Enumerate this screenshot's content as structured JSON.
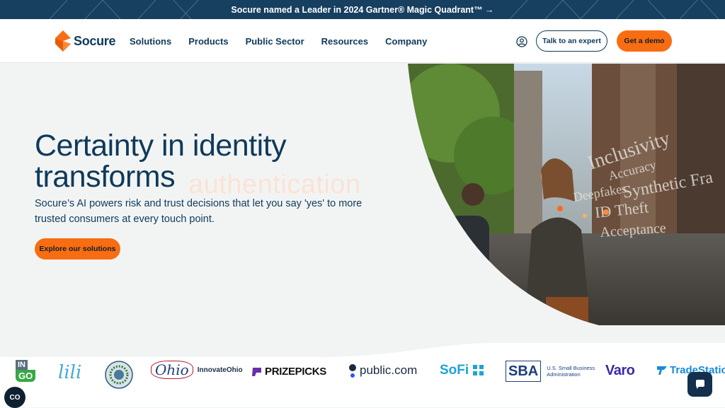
{
  "banner": {
    "text": "Socure named a Leader in 2024 Gartner® Magic Quadrant™ →"
  },
  "nav": {
    "logo_text": "Socure",
    "items": [
      "Solutions",
      "Products",
      "Public Sector",
      "Resources",
      "Company"
    ],
    "expert_label": "Talk to an expert",
    "demo_label": "Get a demo",
    "user_icon": "user-circle-icon"
  },
  "hero": {
    "headline_1": "Certainty in identity",
    "headline_2": "transforms",
    "rotating_word": "authentication",
    "subtitle": "Socure’s AI powers risk and trust decisions that let you say 'yes' to more trusted consumers at every touch point.",
    "cta_label": "Explore our solutions",
    "overlay_words": [
      "Inclusivity",
      "Accuracy",
      "Deepfakes",
      "Synthetic Fra",
      "ID Theft",
      "Acceptance"
    ]
  },
  "logos": {
    "ingo_top": "IN",
    "ingo_bottom": "GO",
    "lili": "lili",
    "ohio": "Ohio",
    "innovate_ohio": "InnovateOhio",
    "prizepicks": "PRIZEPICKS",
    "public": "public.com",
    "sofi": "SoFi",
    "sba": "SBA",
    "sba_line1": "U.S. Small Business",
    "sba_line2": "Administration",
    "varo": "Varo",
    "tradestation": "TradeStatio"
  },
  "widgets": {
    "cookie_label": "CO",
    "chat_icon": "chat-icon"
  },
  "colors": {
    "navy": "#0f3a5a",
    "orange": "#f96d12",
    "banner": "#163f60"
  }
}
